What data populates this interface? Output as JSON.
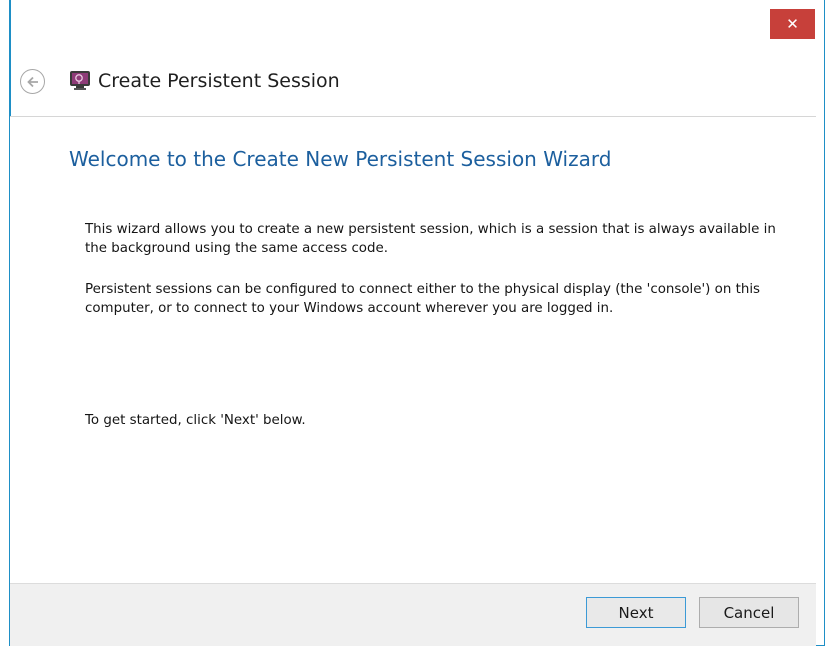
{
  "window": {
    "title": "Create Persistent Session",
    "close_label": "✕"
  },
  "icons": {
    "back": "back-arrow-icon",
    "app": "persistent-session-app-icon"
  },
  "wizard": {
    "heading": "Welcome to the Create New Persistent Session Wizard",
    "paragraphs": [
      "This wizard allows you to create a new persistent session, which is a session that is always available in the background using the same access code.",
      "Persistent sessions can be configured to connect either to the physical display (the 'console') on this computer, or to connect to your Windows account wherever you are logged in.",
      "To get started, click 'Next' below."
    ]
  },
  "footer": {
    "next_label": "Next",
    "cancel_label": "Cancel"
  },
  "colors": {
    "accent_border": "#1e8fc6",
    "close_button": "#c7403a",
    "heading_text": "#1c5f9e",
    "footer_bg": "#f0f0f0"
  }
}
